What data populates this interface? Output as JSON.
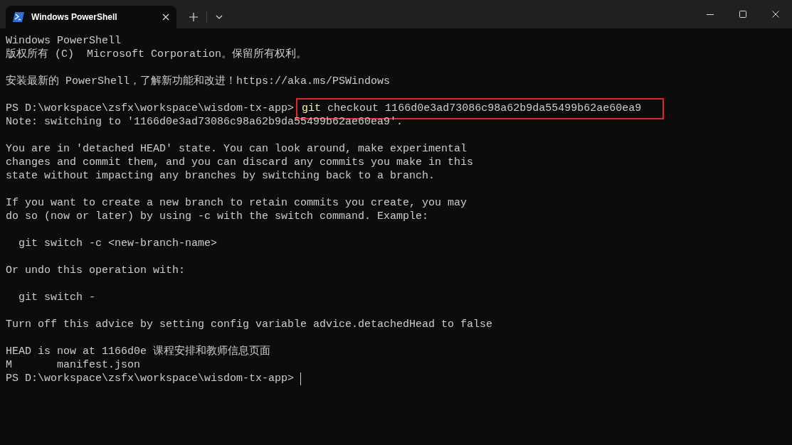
{
  "tab": {
    "title": "Windows PowerShell",
    "selected": true
  },
  "lines": [
    {
      "kind": "output",
      "text": "Windows PowerShell"
    },
    {
      "kind": "output",
      "text": "版权所有 (C)  Microsoft Corporation。保留所有权利。"
    },
    {
      "kind": "blank"
    },
    {
      "kind": "output",
      "text": "安装最新的 PowerShell，了解新功能和改进！https://aka.ms/PSWindows"
    },
    {
      "kind": "blank"
    },
    {
      "kind": "prompt",
      "prompt": "PS D:\\workspace\\zsfx\\workspace\\wisdom-tx-app>",
      "program": "git",
      "args": "checkout 1166d0e3ad73086c98a62b9da55499b62ae60ea9",
      "highlighted": true
    },
    {
      "kind": "output",
      "text": "Note: switching to '1166d0e3ad73086c98a62b9da55499b62ae60ea9'."
    },
    {
      "kind": "blank"
    },
    {
      "kind": "output",
      "text": "You are in 'detached HEAD' state. You can look around, make experimental"
    },
    {
      "kind": "output",
      "text": "changes and commit them, and you can discard any commits you make in this"
    },
    {
      "kind": "output",
      "text": "state without impacting any branches by switching back to a branch."
    },
    {
      "kind": "blank"
    },
    {
      "kind": "output",
      "text": "If you want to create a new branch to retain commits you create, you may"
    },
    {
      "kind": "output",
      "text": "do so (now or later) by using -c with the switch command. Example:"
    },
    {
      "kind": "blank"
    },
    {
      "kind": "output",
      "text": "  git switch -c <new-branch-name>"
    },
    {
      "kind": "blank"
    },
    {
      "kind": "output",
      "text": "Or undo this operation with:"
    },
    {
      "kind": "blank"
    },
    {
      "kind": "output",
      "text": "  git switch -"
    },
    {
      "kind": "blank"
    },
    {
      "kind": "output",
      "text": "Turn off this advice by setting config variable advice.detachedHead to false"
    },
    {
      "kind": "blank"
    },
    {
      "kind": "output",
      "text": "HEAD is now at 1166d0e 课程安排和教师信息页面"
    },
    {
      "kind": "output",
      "text": "M       manifest.json"
    },
    {
      "kind": "prompt",
      "prompt": "PS D:\\workspace\\zsfx\\workspace\\wisdom-tx-app>",
      "cursor": true
    }
  ]
}
